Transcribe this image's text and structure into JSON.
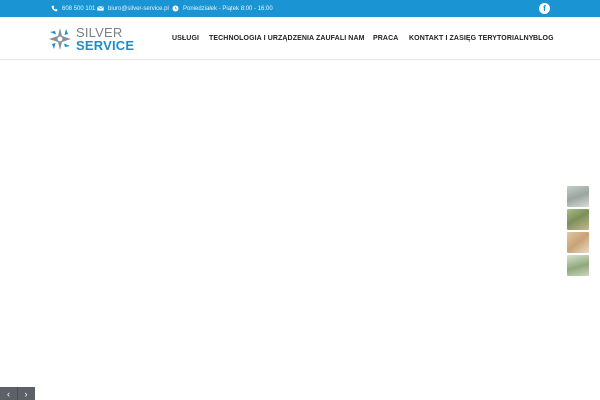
{
  "topbar": {
    "phone": "608 500 101",
    "email": "biuro@silver-service.pl",
    "hours": "Poniedziałek - Piątek 8:00 - 16:00",
    "facebook_glyph": "f"
  },
  "logo": {
    "line1": "SILVER",
    "line2": "SERVICE"
  },
  "nav": {
    "items": [
      "USŁUGI",
      "TECHNOLOGIA I URZĄDZENIA",
      "ZAUFALI NAM",
      "PRACA",
      "KONTAKT I ZASIĘG TERYTORIALNY",
      "BLOG"
    ]
  },
  "slider": {
    "prev_glyph": "‹",
    "next_glyph": "›"
  },
  "colors": {
    "topbar": "#1b94d4",
    "brand_blue": "#1a8fd0",
    "brand_grey": "#7a7f86",
    "arrow_bg": "#5b6166"
  },
  "icons": [
    "phone-icon",
    "mail-icon",
    "clock-icon",
    "facebook-icon",
    "logo-star-icon",
    "chevron-left-icon",
    "chevron-right-icon"
  ]
}
